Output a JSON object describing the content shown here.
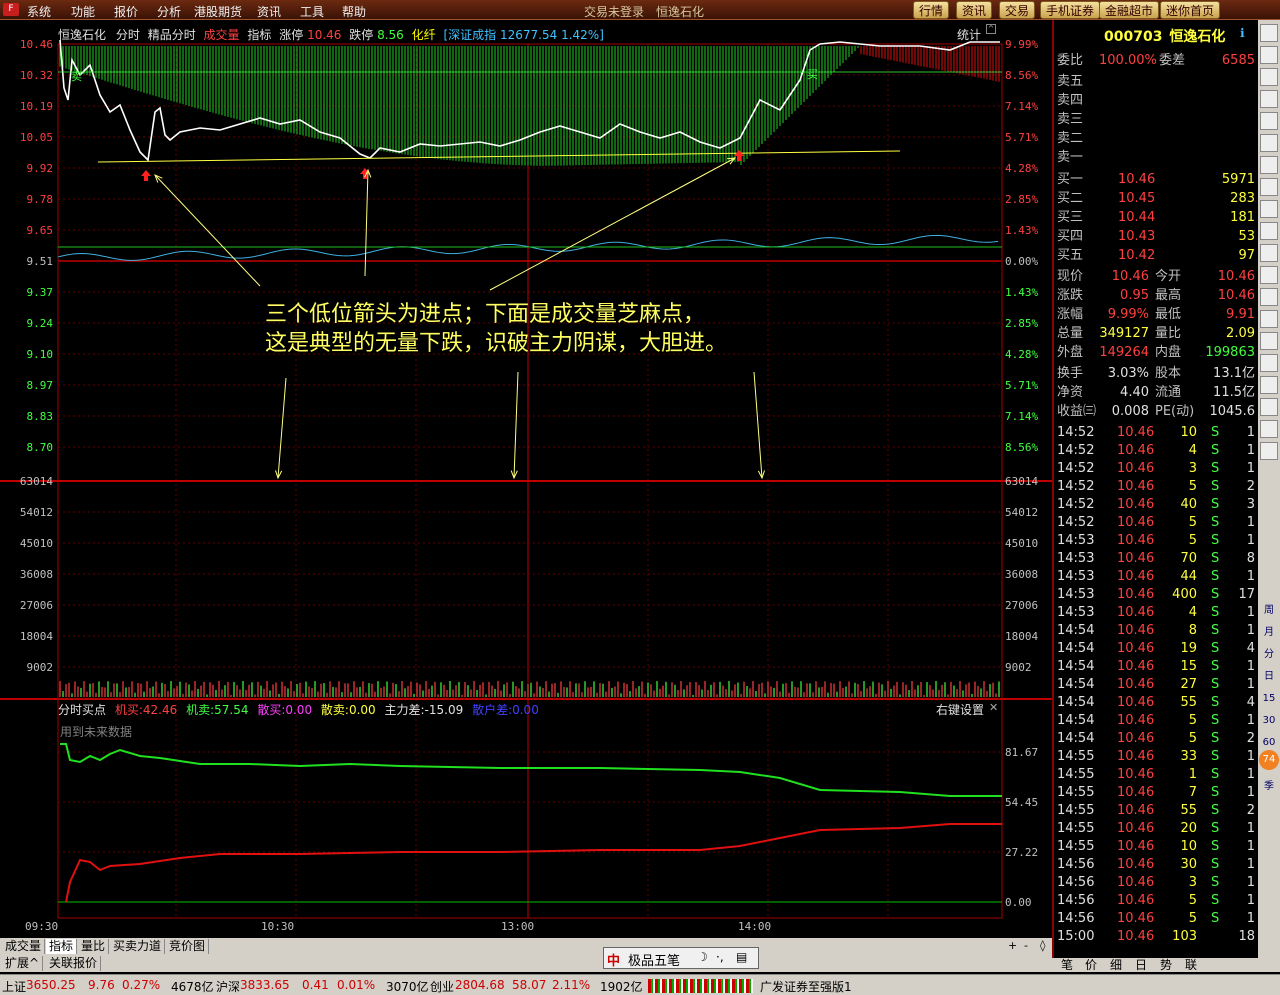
{
  "menu": [
    "系统",
    "功能",
    "报价",
    "分析",
    "港股期货",
    "资讯",
    "工具",
    "帮助"
  ],
  "window": {
    "login": "交易未登录",
    "title": "恒逸石化"
  },
  "right_buttons": [
    "行情",
    "资讯",
    "交易",
    "手机证券",
    "金融超市",
    "迷你首页"
  ],
  "chart_header": {
    "name": "恒逸石化",
    "mode1": "分时",
    "mode2": "精品分时",
    "vol_label": "成交量",
    "ind_label": "指标",
    "limit_up_label": "涨停",
    "limit_up": "10.46",
    "limit_down_label": "跌停",
    "limit_down": "8.56",
    "hua": "化纤",
    "index_name": "[深证成指",
    "index_val": "12677.54 1.42%]",
    "stat_label": "统计"
  },
  "price_axis": {
    "left": [
      "10.46",
      "10.32",
      "10.19",
      "10.05",
      "9.92",
      "9.78",
      "9.65",
      "9.51",
      "9.37",
      "9.24",
      "9.10",
      "8.97",
      "8.83",
      "8.70"
    ],
    "right": [
      "9.99%",
      "8.56%",
      "7.14%",
      "5.71%",
      "4.28%",
      "2.85%",
      "1.43%",
      "0.00%",
      "1.43%",
      "2.85%",
      "4.28%",
      "5.71%",
      "7.14%",
      "8.56%"
    ]
  },
  "vol_axis": {
    "left": [
      "63014",
      "54012",
      "45010",
      "36008",
      "27006",
      "18004",
      "9002"
    ],
    "right": [
      "63014",
      "54012",
      "45010",
      "36008",
      "27006",
      "18004",
      "9002"
    ]
  },
  "ind_header": {
    "name": "分时买点",
    "jm_label": "机买:",
    "jm": "42.46",
    "js_label": "机卖:",
    "js": "57.54",
    "sm_label": "散买:",
    "sm": "0.00",
    "ss_label": "散卖:",
    "ss": "0.00",
    "zl_label": "主力差:",
    "zl": "-15.09",
    "sh_label": "散户差:",
    "sh": "0.00",
    "setting": "右键设置",
    "future": "用到未来数据"
  },
  "ind_axis": [
    "81.67",
    "54.45",
    "27.22",
    "0.00"
  ],
  "time_axis": [
    "09:30",
    "10:30",
    "13:00",
    "14:00"
  ],
  "annotation": {
    "line1": "三个低位箭头为进点；下面是成交量芝麻点，",
    "line2": "这是典型的无量下跌，识破主力阴谋，大胆进。"
  },
  "marks": {
    "buy": "买",
    "sell": "卖"
  },
  "stock": {
    "code": "000703",
    "name": "恒逸石化",
    "wb_label": "委比",
    "wb": "100.00%",
    "wc_label": "委差",
    "wc": "6585",
    "sell": [
      "卖五",
      "卖四",
      "卖三",
      "卖二",
      "卖一"
    ],
    "buy": [
      [
        "买一",
        "10.46",
        "5971"
      ],
      [
        "买二",
        "10.45",
        "283"
      ],
      [
        "买三",
        "10.44",
        "181"
      ],
      [
        "买四",
        "10.43",
        "53"
      ],
      [
        "买五",
        "10.42",
        "97"
      ]
    ],
    "quotes": [
      [
        "现价",
        "10.46",
        "今开",
        "10.46"
      ],
      [
        "涨跌",
        "0.95",
        "最高",
        "10.46"
      ],
      [
        "涨幅",
        "9.99%",
        "最低",
        "9.91"
      ],
      [
        "总量",
        "349127",
        "量比",
        "2.09"
      ],
      [
        "外盘",
        "149264",
        "内盘",
        "199863"
      ]
    ],
    "quotes2": [
      [
        "换手",
        "3.03%",
        "股本",
        "13.1亿"
      ],
      [
        "净资",
        "4.40",
        "流通",
        "11.5亿"
      ],
      [
        "收益㈢",
        "0.008",
        "PE(动)",
        "1045.6"
      ]
    ]
  },
  "ticks": [
    [
      "14:52",
      "10.46",
      "10",
      "S",
      "1"
    ],
    [
      "14:52",
      "10.46",
      "4",
      "S",
      "1"
    ],
    [
      "14:52",
      "10.46",
      "3",
      "S",
      "1"
    ],
    [
      "14:52",
      "10.46",
      "5",
      "S",
      "2"
    ],
    [
      "14:52",
      "10.46",
      "40",
      "S",
      "3"
    ],
    [
      "14:52",
      "10.46",
      "5",
      "S",
      "1"
    ],
    [
      "14:53",
      "10.46",
      "5",
      "S",
      "1"
    ],
    [
      "14:53",
      "10.46",
      "70",
      "S",
      "8"
    ],
    [
      "14:53",
      "10.46",
      "44",
      "S",
      "1"
    ],
    [
      "14:53",
      "10.46",
      "400",
      "S",
      "17"
    ],
    [
      "14:53",
      "10.46",
      "4",
      "S",
      "1"
    ],
    [
      "14:54",
      "10.46",
      "8",
      "S",
      "1"
    ],
    [
      "14:54",
      "10.46",
      "19",
      "S",
      "4"
    ],
    [
      "14:54",
      "10.46",
      "15",
      "S",
      "1"
    ],
    [
      "14:54",
      "10.46",
      "27",
      "S",
      "1"
    ],
    [
      "14:54",
      "10.46",
      "55",
      "S",
      "4"
    ],
    [
      "14:54",
      "10.46",
      "5",
      "S",
      "1"
    ],
    [
      "14:54",
      "10.46",
      "5",
      "S",
      "2"
    ],
    [
      "14:55",
      "10.46",
      "33",
      "S",
      "1"
    ],
    [
      "14:55",
      "10.46",
      "1",
      "S",
      "1"
    ],
    [
      "14:55",
      "10.46",
      "7",
      "S",
      "1"
    ],
    [
      "14:55",
      "10.46",
      "55",
      "S",
      "2"
    ],
    [
      "14:55",
      "10.46",
      "20",
      "S",
      "1"
    ],
    [
      "14:55",
      "10.46",
      "10",
      "S",
      "1"
    ],
    [
      "14:56",
      "10.46",
      "30",
      "S",
      "1"
    ],
    [
      "14:56",
      "10.46",
      "3",
      "S",
      "1"
    ],
    [
      "14:56",
      "10.46",
      "5",
      "S",
      "1"
    ],
    [
      "14:56",
      "10.46",
      "5",
      "S",
      "1"
    ],
    [
      "15:00",
      "10.46",
      "103",
      "",
      "18"
    ]
  ],
  "toolbar": [
    "周",
    "月",
    "分",
    "日",
    "15",
    "30",
    "60",
    "年",
    "季"
  ],
  "toolbar_badge": "74",
  "rp_tabs": [
    "笔",
    "价",
    "细",
    "日",
    "势",
    "联"
  ],
  "bottom_tabs": [
    "成交量",
    "指标",
    "量比",
    "买卖力道",
    "竞价图"
  ],
  "bottom_tabs2": [
    "扩展^",
    "关联报价"
  ],
  "ime": {
    "mark": "中",
    "name": "极品五笔"
  },
  "status": {
    "sh_label": "上证",
    "sh": "3650.25",
    "sh_chg": "9.76",
    "sh_pct": "0.27%",
    "sh_amt": "4678亿",
    "sz_label": "沪深",
    "sz": "3833.65",
    "sz_chg": "0.41",
    "sz_pct": "0.01%",
    "sz_amt": "3070亿",
    "cy_label": "创业",
    "cy": "2804.68",
    "cy_chg": "58.07",
    "cy_pct": "2.11%",
    "cy_amt": "1902亿",
    "broker": "广发证券至强版1"
  }
}
